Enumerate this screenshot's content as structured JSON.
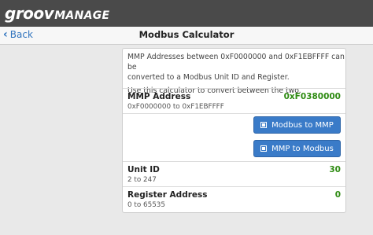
{
  "app": {
    "logo_groov": "groov",
    "logo_manage": "MANAGE"
  },
  "nav": {
    "back_label": "Back",
    "title": "Modbus Calculator"
  },
  "intro": {
    "line1": "MMP Addresses between 0xF0000000 and 0xF1EBFFFF can be",
    "line2": "converted to a Modbus Unit ID and Register.",
    "line3": "Use this calculator to convert between the two."
  },
  "mmp": {
    "label": "MMP Address",
    "range": "0xF0000000 to 0xF1EBFFFF",
    "value": "0xF0380000"
  },
  "buttons": {
    "modbus_to_mmp": "Modbus to MMP",
    "mmp_to_modbus": "MMP to Modbus"
  },
  "unit": {
    "label": "Unit ID",
    "range": "2 to 247",
    "value": "30"
  },
  "register": {
    "label": "Register Address",
    "range": "0 to 65535",
    "value": "0"
  },
  "colors": {
    "accent": "#3a7bc8",
    "value_green": "#2e8b12",
    "topbar": "#4a4a4a"
  },
  "icons": {
    "back": "chevron-left-icon",
    "button": "square-icon"
  }
}
